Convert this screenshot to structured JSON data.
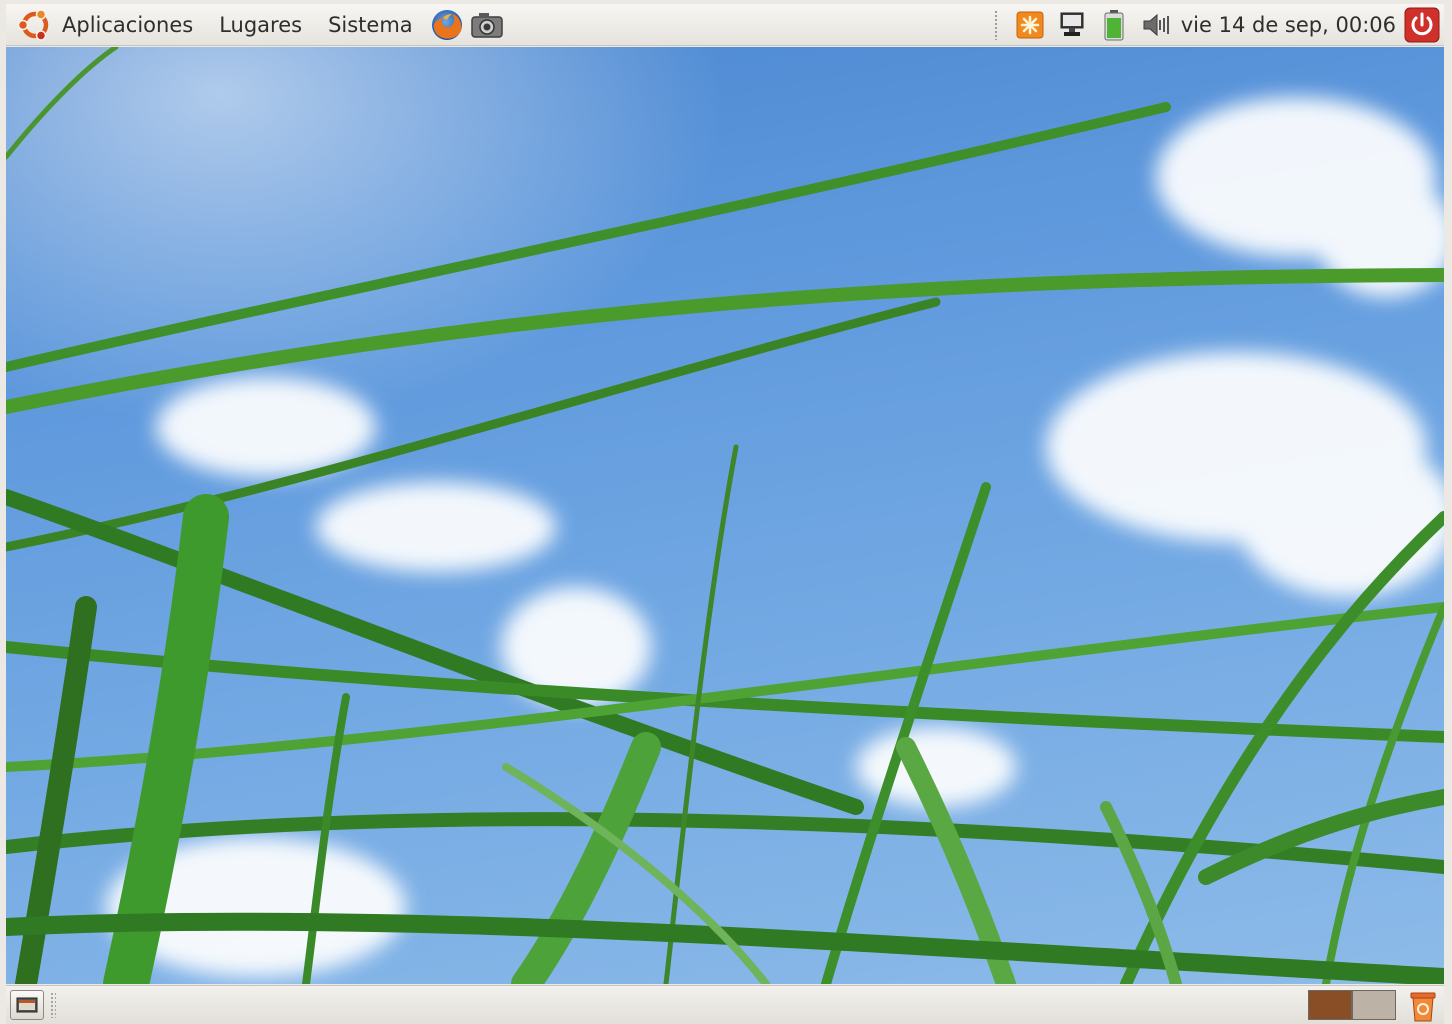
{
  "top_panel": {
    "menus": [
      {
        "label": "Aplicaciones"
      },
      {
        "label": "Lugares"
      },
      {
        "label": "Sistema"
      }
    ],
    "launchers": [
      "firefox-icon",
      "screenshot-camera-icon"
    ],
    "tray_icons": [
      "update-notifier-icon",
      "network-monitor-icon",
      "battery-icon",
      "volume-icon"
    ],
    "clock": "vie 14 de sep, 00:06",
    "power_icon": "power-icon"
  },
  "desktop": {
    "wallpaper": "grass-and-blue-sky"
  },
  "bottom_panel": {
    "show_desktop_icon": "show-desktop-icon",
    "workspaces": [
      {
        "name": "workspace-1",
        "color": "#8a4e26",
        "active": true
      },
      {
        "name": "workspace-2",
        "color": "#bcb2a6",
        "active": false
      }
    ],
    "trash_icon": "trash-icon"
  },
  "colors": {
    "panel": "#eeebe6",
    "accent_orange": "#e05a1c",
    "power_red": "#d0302a",
    "sky": "#5f99dd",
    "grass": "#3f8f2a"
  }
}
